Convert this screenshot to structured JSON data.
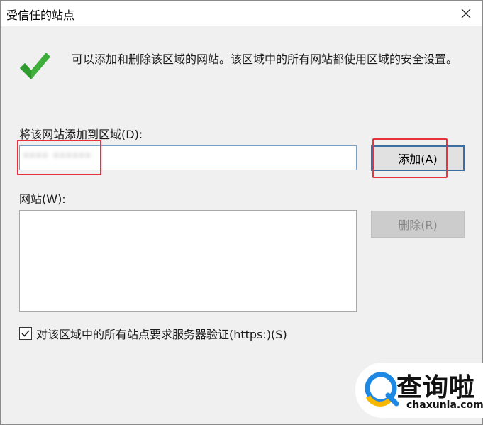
{
  "window": {
    "title": "受信任的站点"
  },
  "description": "可以添加和删除该区域的网站。该区域中的所有网站都使用区域的安全设置。",
  "add_site": {
    "label": "将该网站添加到区域(D):",
    "value": "**** ******",
    "button": "添加(A)"
  },
  "sites": {
    "label": "网站(W):",
    "items": [],
    "remove_button": "删除(R)"
  },
  "verify": {
    "checked": true,
    "label": "对该区域中的所有站点要求服务器验证(https:)(S)"
  },
  "watermark": {
    "name": "查询啦",
    "url": "chaxunla.com"
  },
  "colors": {
    "accent_border": "#3a6ea5",
    "highlight_red": "#e8313f",
    "check_green": "#3dae3a",
    "watermark_blue": "#1e88e5",
    "watermark_yellow": "#f5b700"
  },
  "icons": [
    "close-icon",
    "green-check-icon",
    "checkbox-check-icon",
    "chaxunla-logo-icon"
  ]
}
